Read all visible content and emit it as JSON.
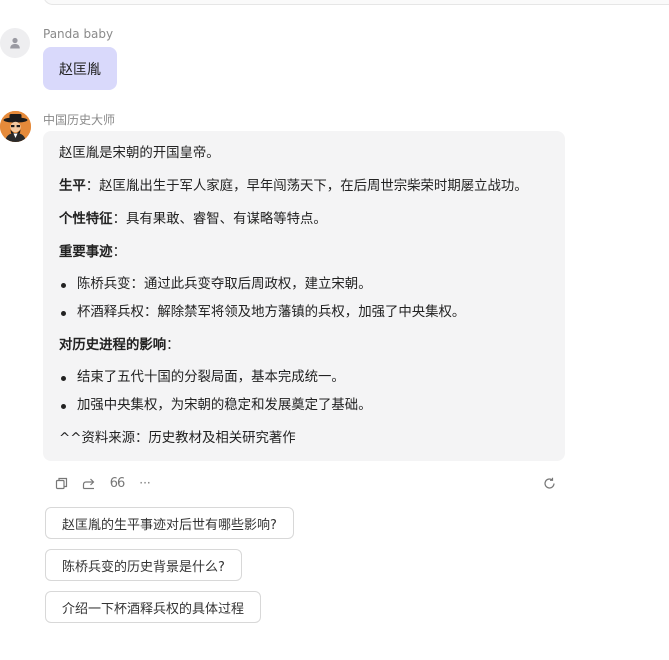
{
  "user_message": {
    "name": "Panda baby",
    "text": "赵匡胤"
  },
  "assistant_message": {
    "name": "中国历史大师",
    "intro": "赵匡胤是宋朝的开国皇帝。",
    "life_label": "生平",
    "life_text": "：赵匡胤出生于军人家庭，早年闯荡天下，在后周世宗柴荣时期屡立战功。",
    "traits_label": "个性特征",
    "traits_text": "：具有果敢、睿智、有谋略等特点。",
    "events_label": "重要事迹",
    "events_colon": "：",
    "events": [
      "陈桥兵变：通过此兵变夺取后周政权，建立宋朝。",
      "杯酒释兵权：解除禁军将领及地方藩镇的兵权，加强了中央集权。"
    ],
    "impact_label": "对历史进程的影响",
    "impact_colon": "：",
    "impacts": [
      "结束了五代十国的分裂局面，基本完成统一。",
      "加强中央集权，为宋朝的稳定和发展奠定了基础。"
    ],
    "source": "^^资料来源：历史教材及相关研究著作"
  },
  "actions": {
    "quote_label": "66",
    "more_label": "···"
  },
  "suggestions": [
    "赵匡胤的生平事迹对后世有哪些影响?",
    "陈桥兵变的历史背景是什么?",
    "介绍一下杯酒释兵权的具体过程"
  ],
  "icons": [
    "user-icon",
    "copy-icon",
    "share-icon",
    "quote-icon",
    "more-icon",
    "refresh-icon"
  ],
  "colors": {
    "user_bubble": "#d9d9fb",
    "bot_bubble": "#f4f4f5",
    "avatar_orange": "#e58a3a"
  }
}
